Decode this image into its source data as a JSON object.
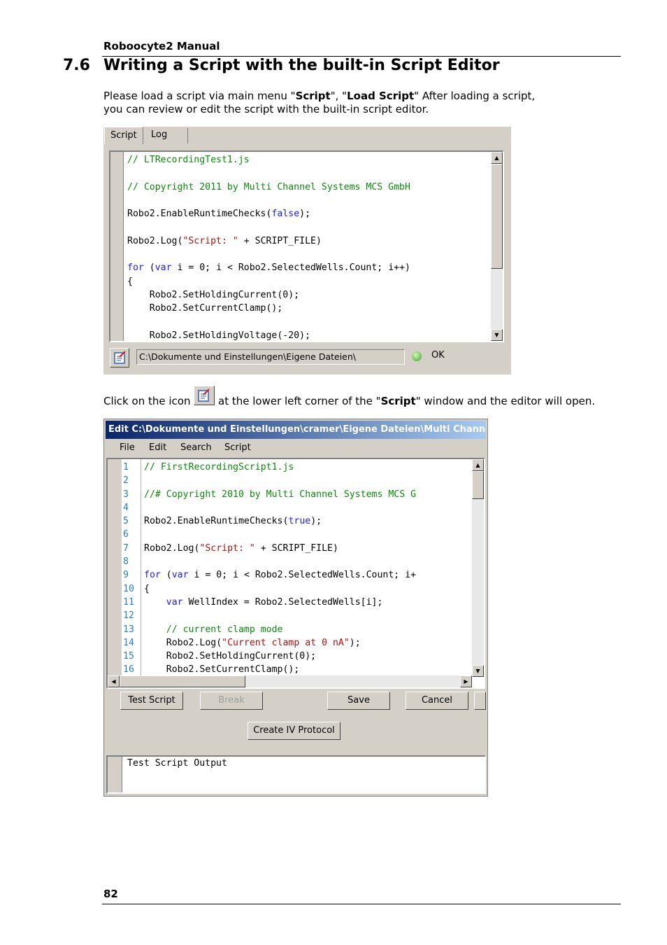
{
  "header": {
    "manual_title": "Roboocyte2  Manual"
  },
  "section": {
    "number": "7.6",
    "title": "Writing a Script with the built-in Script Editor"
  },
  "intro": {
    "t1": "Please load a script via main menu \"",
    "b1": "Script",
    "t2": "\", \"",
    "b2": "Load Script",
    "t3": "\" After loading a script,",
    "line2": "you can review or edit the script with the built-in script editor."
  },
  "script_window": {
    "tabs": [
      "Script",
      "Log"
    ],
    "path": "C:\\Dokumente und Einstellungen\\Eigene Dateien\\",
    "status": "OK",
    "code_lines": [
      "// LTRecordingTest1.js",
      "",
      "// Copyright 2011 by Multi Channel Systems MCS GmbH",
      "",
      "Robo2.EnableRuntimeChecks(false);",
      "",
      "Robo2.Log(\"Script: \" + SCRIPT_FILE)",
      "",
      "for (var i = 0; i < Robo2.SelectedWells.Count; i++)",
      "{",
      "    Robo2.SetHoldingCurrent(0);",
      "    Robo2.SetCurrentClamp();",
      "",
      "    Robo2.SetHoldingVoltage(-20);"
    ]
  },
  "click_text": {
    "before": "Click on the icon ",
    "after_1": "at the lower left corner of the \"",
    "bold": "Script",
    "after_2": "\" window and the editor will open."
  },
  "editor": {
    "title": "Edit C:\\Dokumente und Einstellungen\\cramer\\Eigene Dateien\\Multi Channel S...",
    "menu": [
      "File",
      "Edit",
      "Search",
      "Script"
    ],
    "line_numbers": [
      "1",
      "2",
      "3",
      "4",
      "5",
      "6",
      "7",
      "8",
      "9",
      "10",
      "11",
      "12",
      "13",
      "14",
      "15",
      "16"
    ],
    "code_lines": [
      "// FirstRecordingScript1.js",
      "",
      "//# Copyright 2010 by Multi Channel Systems MCS G",
      "",
      "Robo2.EnableRuntimeChecks(true);",
      "",
      "Robo2.Log(\"Script: \" + SCRIPT_FILE)",
      "",
      "for (var i = 0; i < Robo2.SelectedWells.Count; i+",
      "{",
      "    var WellIndex = Robo2.SelectedWells[i];",
      "",
      "    // current clamp mode",
      "    Robo2.Log(\"Current clamp at 0 nA\");",
      "    Robo2.SetHoldingCurrent(0);",
      "    Robo2.SetCurrentClamp();"
    ],
    "buttons": {
      "test": "Test Script",
      "break": "Break",
      "save": "Save",
      "cancel": "Cancel",
      "create_iv": "Create IV Protocol"
    },
    "output": "Test Script Output"
  },
  "footer": {
    "page_number": "82"
  },
  "colors": {
    "comment": "#0a8a0a",
    "keyword": "#1a1aff",
    "string": "#b01010",
    "titlebar": "#0a246a",
    "line_number": "#1f7fd0"
  }
}
